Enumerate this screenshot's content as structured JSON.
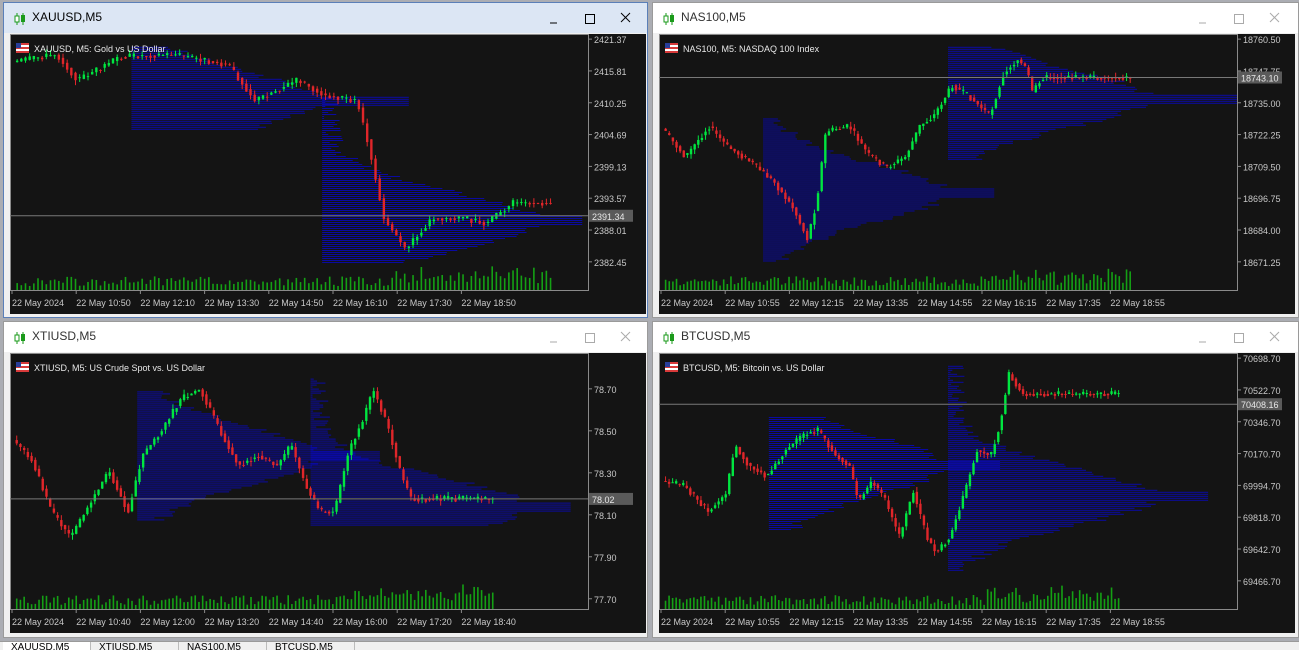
{
  "colors": {
    "bull": "#00e640",
    "bear": "#e0262a",
    "profile": "#0a0aa0",
    "volume": "#14a014",
    "grid": "#404040",
    "axis_text": "#c8c8c8",
    "price_line": "#787878"
  },
  "windows": [
    {
      "title": "XAUUSD,M5",
      "active": true,
      "chart_label": "XAUUSD, M5:  Gold vs US Dollar",
      "y_labels": [
        "2421.37",
        "2415.81",
        "2410.25",
        "2404.69",
        "2399.13",
        "2393.57",
        "2388.01",
        "2382.45"
      ],
      "current_price": "2391.34",
      "x_labels": [
        "22 May 2024",
        "22 May 10:50",
        "22 May 12:10",
        "22 May 13:30",
        "22 May 14:50",
        "22 May 16:10",
        "22 May 17:30",
        "22 May 18:50"
      ]
    },
    {
      "title": "NAS100,M5",
      "active": false,
      "chart_label": "NAS100, M5:  NASDAQ 100 Index",
      "y_labels": [
        "18760.50",
        "18747.75",
        "18735.00",
        "18722.25",
        "18709.50",
        "18696.75",
        "18684.00",
        "18671.25"
      ],
      "current_price": "18743.10",
      "x_labels": [
        "22 May 2024",
        "22 May 10:55",
        "22 May 12:15",
        "22 May 13:35",
        "22 May 14:55",
        "22 May 16:15",
        "22 May 17:35",
        "22 May 18:55"
      ]
    },
    {
      "title": "XTIUSD,M5",
      "active": false,
      "chart_label": "XTIUSD, M5:  US Crude Spot vs. US Dollar",
      "y_labels": [
        "78.70",
        "78.50",
        "78.30",
        "78.10",
        "77.90",
        "77.70"
      ],
      "current_price": "78.02",
      "x_labels": [
        "22 May 2024",
        "22 May 10:40",
        "22 May 12:00",
        "22 May 13:20",
        "22 May 14:40",
        "22 May 16:00",
        "22 May 17:20",
        "22 May 18:40"
      ]
    },
    {
      "title": "BTCUSD,M5",
      "active": false,
      "chart_label": "BTCUSD, M5:  Bitcoin vs. US Dollar",
      "y_labels": [
        "70698.70",
        "70522.70",
        "70346.70",
        "70170.70",
        "69994.70",
        "69818.70",
        "69642.70",
        "69466.70"
      ],
      "current_price": "70408.16",
      "x_labels": [
        "22 May 2024",
        "22 May 10:55",
        "22 May 12:15",
        "22 May 13:35",
        "22 May 14:55",
        "22 May 16:15",
        "22 May 17:35",
        "22 May 18:55"
      ]
    }
  ],
  "tabs": [
    "XAUUSD,M5",
    "XTIUSD,M5",
    "NAS100,M5",
    "BTCUSD,M5"
  ],
  "icons": {
    "window": "candlestick-icon",
    "minimize": "minimize-icon",
    "maximize": "maximize-icon",
    "close": "close-icon",
    "label": "flag-icon"
  }
}
